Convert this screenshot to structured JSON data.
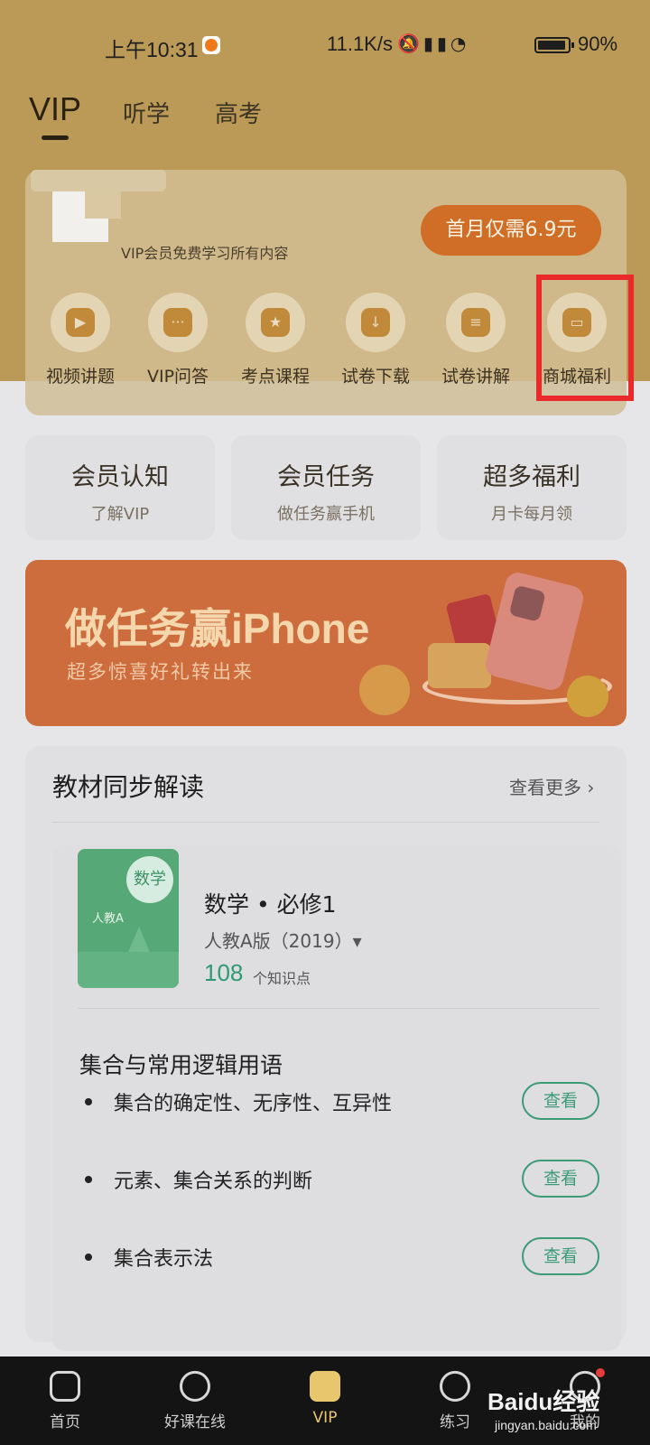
{
  "status_bar": {
    "time": "上午10:31",
    "network_speed": "11.1K/s",
    "battery": "90%"
  },
  "top_tabs": [
    {
      "label": "VIP",
      "active": true
    },
    {
      "label": "听学",
      "active": false
    },
    {
      "label": "高考",
      "active": false
    }
  ],
  "vip_card": {
    "description": "VIP会员免费学习所有内容",
    "promo_button": "首月仅需6.9元"
  },
  "features": [
    {
      "label": "视频讲题",
      "icon": "video-icon",
      "glyph": "▶"
    },
    {
      "label": "VIP问答",
      "icon": "chat-bubble-icon",
      "glyph": "···"
    },
    {
      "label": "考点课程",
      "icon": "star-bulb-icon",
      "glyph": "★"
    },
    {
      "label": "试卷下载",
      "icon": "download-box-icon",
      "glyph": "↓"
    },
    {
      "label": "试卷讲解",
      "icon": "document-icon",
      "glyph": "≡"
    },
    {
      "label": "商城福利",
      "icon": "wallet-icon",
      "glyph": "▭"
    }
  ],
  "quick_cards": [
    {
      "title": "会员认知",
      "subtitle": "了解VIP"
    },
    {
      "title": "会员任务",
      "subtitle": "做任务赢手机"
    },
    {
      "title": "超多福利",
      "subtitle": "月卡每月领"
    }
  ],
  "banner": {
    "title": "做任务赢iPhone",
    "subtitle": "超多惊喜好礼转出来"
  },
  "textbook": {
    "section_title": "教材同步解读",
    "more_label": "查看更多 ›",
    "book": {
      "subject_badge": "数学",
      "publisher": "人教A",
      "name": "数学 • 必修1",
      "edition": "人教A版（2019）▾",
      "count": "108",
      "count_label": "个知识点"
    },
    "chapter_title": "集合与常用逻辑用语",
    "knowledge_points": [
      {
        "label": "集合的确定性、无序性、互异性",
        "button": "查看"
      },
      {
        "label": "元素、集合关系的判断",
        "button": "查看"
      },
      {
        "label": "集合表示法",
        "button": "查看"
      }
    ]
  },
  "bottom_nav": [
    {
      "label": "首页",
      "icon": "home-icon",
      "active": false
    },
    {
      "label": "好课在线",
      "icon": "play-circle-icon",
      "active": false
    },
    {
      "label": "VIP",
      "icon": "crown-icon",
      "active": true
    },
    {
      "label": "练习",
      "icon": "pen-icon",
      "active": false
    },
    {
      "label": "我的",
      "icon": "profile-icon",
      "active": false
    }
  ],
  "watermark": {
    "brand": "Baidu经验",
    "url": "jingyan.baidu.com"
  },
  "colors": {
    "header_brand": "#bb9a57",
    "promo_button": "#d06e28",
    "accent_green": "#3d9b78",
    "highlight": "#ea2a2a",
    "nav_active": "#e8c66e"
  }
}
